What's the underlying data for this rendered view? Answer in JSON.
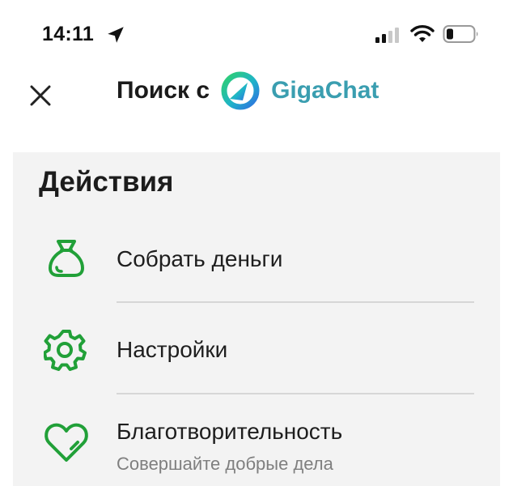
{
  "status_bar": {
    "time": "14:11",
    "icons": [
      "location-arrow-icon",
      "cellular-signal-icon",
      "wifi-icon",
      "battery-icon"
    ]
  },
  "header": {
    "close_icon": "close-icon",
    "search_label": "Поиск с",
    "brand_name": "GigaChat",
    "brand_color": "#3a9eb0",
    "logo_icon": "gigachat-logo-icon"
  },
  "actions": {
    "heading": "Действия",
    "accent_color": "#21a038",
    "items": [
      {
        "label": "Собрать деньги",
        "icon": "money-bag-icon"
      },
      {
        "label": "Настройки",
        "icon": "gear-icon"
      },
      {
        "label": "Благотворительность",
        "sublabel": "Совершайте добрые дела",
        "icon": "heart-icon"
      }
    ]
  }
}
